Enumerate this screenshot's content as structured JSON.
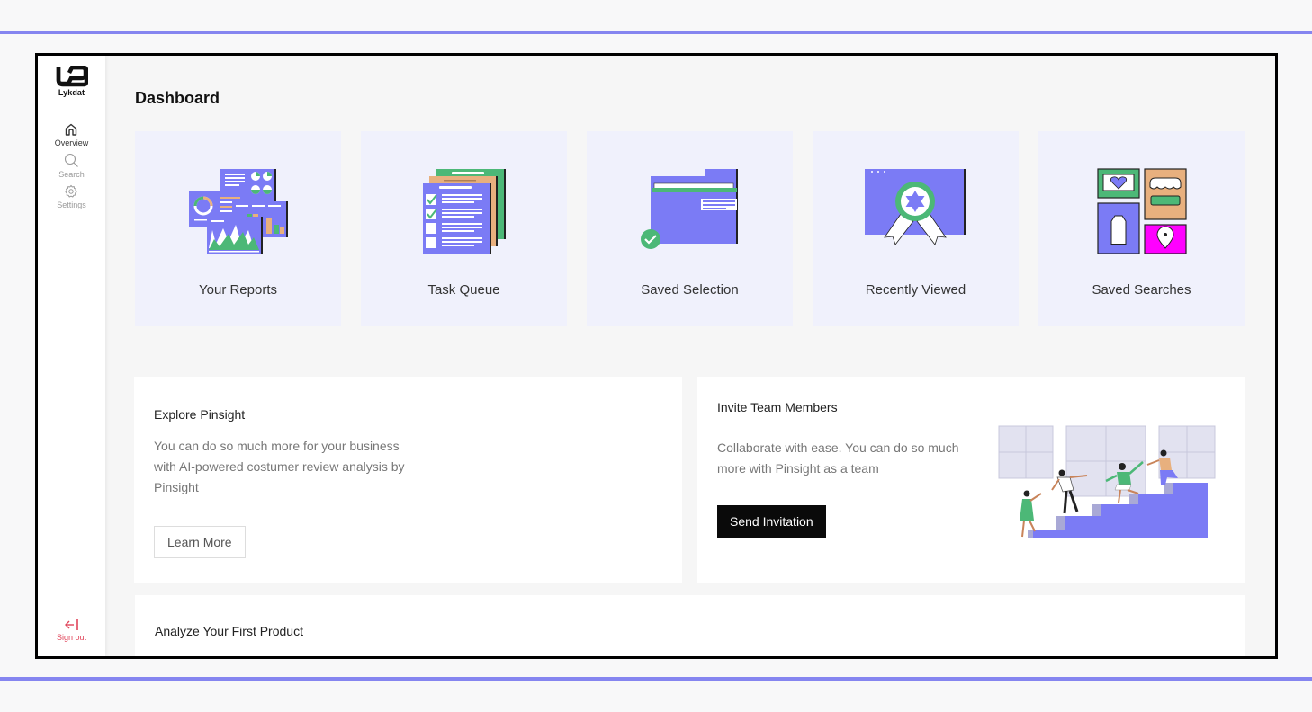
{
  "brand": {
    "name": "Lykdat"
  },
  "sidebar": {
    "items": [
      {
        "label": "Overview",
        "icon": "home-icon",
        "active": true
      },
      {
        "label": "Search",
        "icon": "search-icon",
        "active": false
      },
      {
        "label": "Settings",
        "icon": "gear-icon",
        "active": false
      }
    ],
    "signout": {
      "label": "Sign out",
      "icon": "sign-out-arrow-icon"
    }
  },
  "page": {
    "title": "Dashboard"
  },
  "tiles": [
    {
      "label": "Your Reports",
      "icon": "reports-illustration"
    },
    {
      "label": "Task Queue",
      "icon": "task-checklist-illustration"
    },
    {
      "label": "Saved Selection",
      "icon": "folder-check-illustration"
    },
    {
      "label": "Recently Viewed",
      "icon": "award-ribbon-illustration"
    },
    {
      "label": "Saved Searches",
      "icon": "saved-searches-grid-illustration"
    }
  ],
  "explore": {
    "title": "Explore Pinsight",
    "text_lines": [
      "You can do so much more for your business",
      "with AI-powered costumer review analysis by",
      "Pinsight"
    ],
    "button": "Learn More"
  },
  "invite": {
    "title": "Invite Team Members",
    "text_lines": [
      "Collaborate with ease. You can do so much",
      "more with Pinsight as a team"
    ],
    "button": "Send Invitation",
    "illustration": "team-climbing-stairs-illustration"
  },
  "analyze": {
    "title": "Analyze Your First Product"
  },
  "colors": {
    "accent": "#8585f0",
    "tile_bg": "#f0f1fc",
    "illustration_purple": "#7b7bf5",
    "illustration_green": "#4cb877",
    "illustration_orange": "#e8b07e",
    "illustration_magenta": "#ff00ff",
    "signout": "#e0455a"
  }
}
